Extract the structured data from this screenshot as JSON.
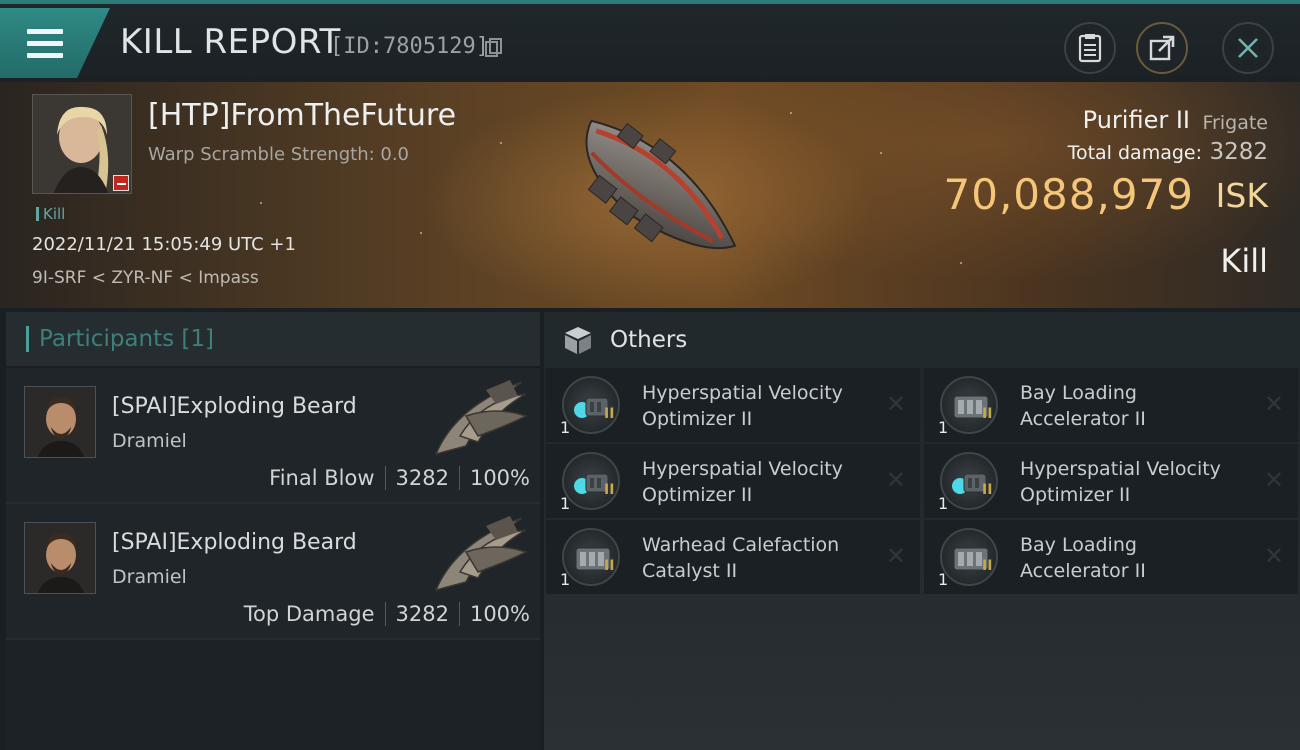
{
  "header": {
    "title": "KILL REPORT",
    "report_id": "[ID:7805129]"
  },
  "victim": {
    "name": "[HTP]FromTheFuture",
    "warp_scramble": "Warp Scramble Strength: 0.0",
    "tag": "Kill",
    "datetime": "2022/11/21 15:05:49 UTC +1",
    "location": "9I-SRF < ZYR-NF < Impass",
    "ship_name": "Purifier II",
    "ship_class": "Frigate",
    "total_damage_label": "Total damage:",
    "total_damage": "3282",
    "isk_value": "70,088,979",
    "isk_unit": "ISK",
    "status": "Kill"
  },
  "participants": {
    "title": "Participants [1]",
    "rows": [
      {
        "name": "[SPAI]Exploding Beard",
        "ship": "Dramiel",
        "role": "Final Blow",
        "damage": "3282",
        "percent": "100%"
      },
      {
        "name": "[SPAI]Exploding Beard",
        "ship": "Dramiel",
        "role": "Top Damage",
        "damage": "3282",
        "percent": "100%"
      }
    ]
  },
  "others": {
    "title": "Others",
    "items": [
      {
        "line1": "Hyperspatial Velocity",
        "line2": "Optimizer II",
        "qty": "1",
        "tier": "II",
        "icon": "velocity-optimizer-icon"
      },
      {
        "line1": "Bay Loading",
        "line2": "Accelerator II",
        "qty": "1",
        "tier": "II",
        "icon": "bay-loading-icon"
      },
      {
        "line1": "Hyperspatial Velocity",
        "line2": "Optimizer II",
        "qty": "1",
        "tier": "II",
        "icon": "velocity-optimizer-icon"
      },
      {
        "line1": "Hyperspatial Velocity",
        "line2": "Optimizer II",
        "qty": "1",
        "tier": "II",
        "icon": "velocity-optimizer-icon"
      },
      {
        "line1": "Warhead Calefaction",
        "line2": "Catalyst II",
        "qty": "1",
        "tier": "II",
        "icon": "warhead-calefaction-icon"
      },
      {
        "line1": "Bay Loading",
        "line2": "Accelerator II",
        "qty": "1",
        "tier": "II",
        "icon": "bay-loading-icon"
      }
    ]
  },
  "colors": {
    "accent": "#2f8a86",
    "isk": "#f3c67a"
  }
}
